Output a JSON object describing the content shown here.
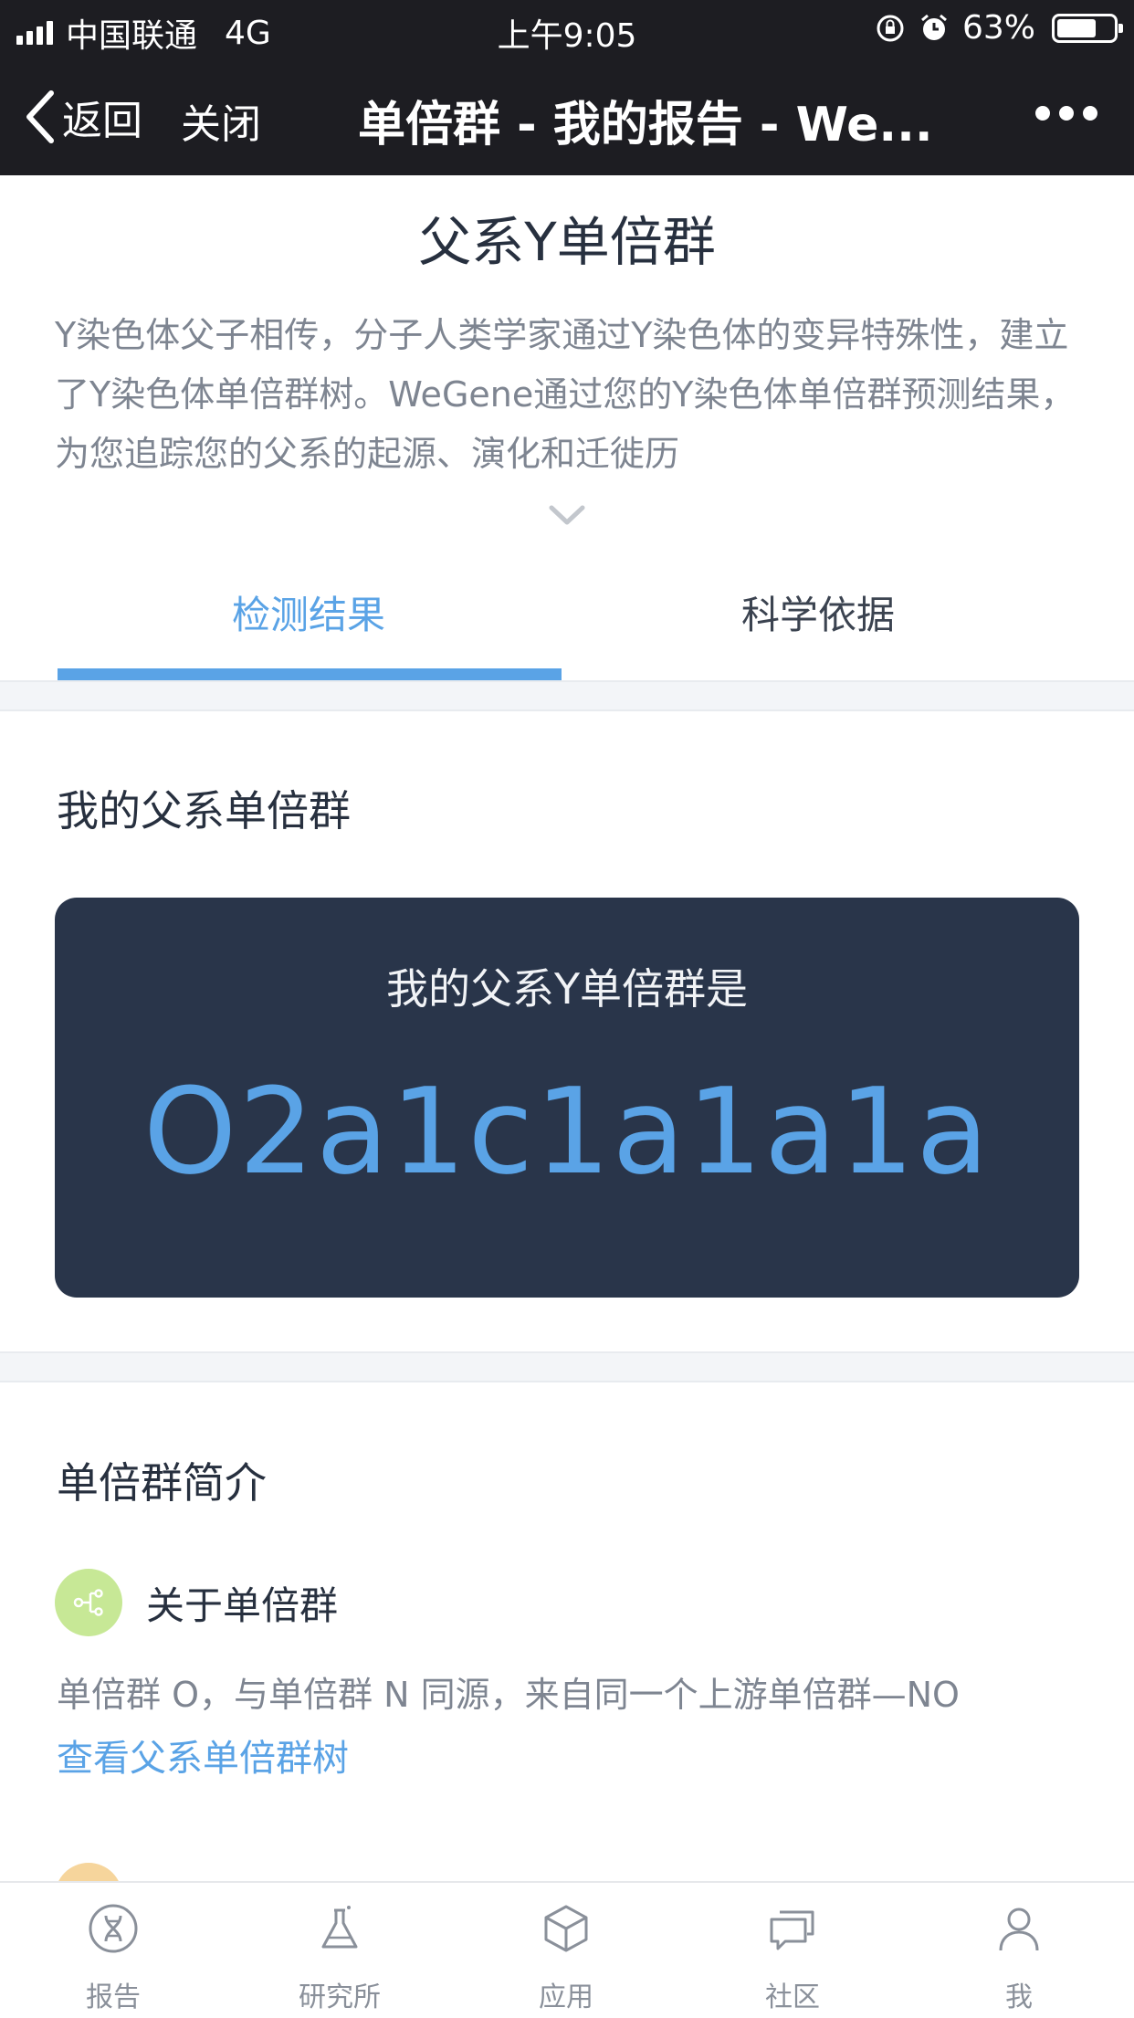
{
  "status_bar": {
    "carrier": "中国联通",
    "network": "4G",
    "time": "上午9:05",
    "battery": "63%",
    "battery_level": 0.63
  },
  "nav": {
    "back_label": "返回",
    "close_label": "关闭",
    "title": "单倍群 - 我的报告 - We..."
  },
  "page": {
    "title": "父系Y单倍群",
    "intro": "Y染色体父子相传，分子人类学家通过Y染色体的变异特殊性，建立了Y染色体单倍群树。WeGene通过您的Y染色体单倍群预测结果，为您追踪您的父系的起源、演化和迁徙历"
  },
  "tabs": [
    {
      "label": "检测结果",
      "active": true
    },
    {
      "label": "科学依据",
      "active": false
    }
  ],
  "result_section": {
    "heading": "我的父系单倍群",
    "card_label": "我的父系Y单倍群是",
    "haplogroup": "O2a1c1a1a1a"
  },
  "intro_section": {
    "heading": "单倍群简介",
    "about_title": "关于单倍群",
    "about_desc": "单倍群 O，与单倍群 N 同源，来自同一个上游单倍群—NO",
    "tree_link": "查看父系单倍群树"
  },
  "tab_bar": [
    {
      "label": "报告",
      "icon": "dna-icon"
    },
    {
      "label": "研究所",
      "icon": "flask-icon"
    },
    {
      "label": "应用",
      "icon": "cube-icon"
    },
    {
      "label": "社区",
      "icon": "chat-icon"
    },
    {
      "label": "我",
      "icon": "user-icon"
    }
  ],
  "colors": {
    "accent": "#5aa3e6",
    "card_bg": "#29354a",
    "header_bg": "#1d1d22"
  }
}
